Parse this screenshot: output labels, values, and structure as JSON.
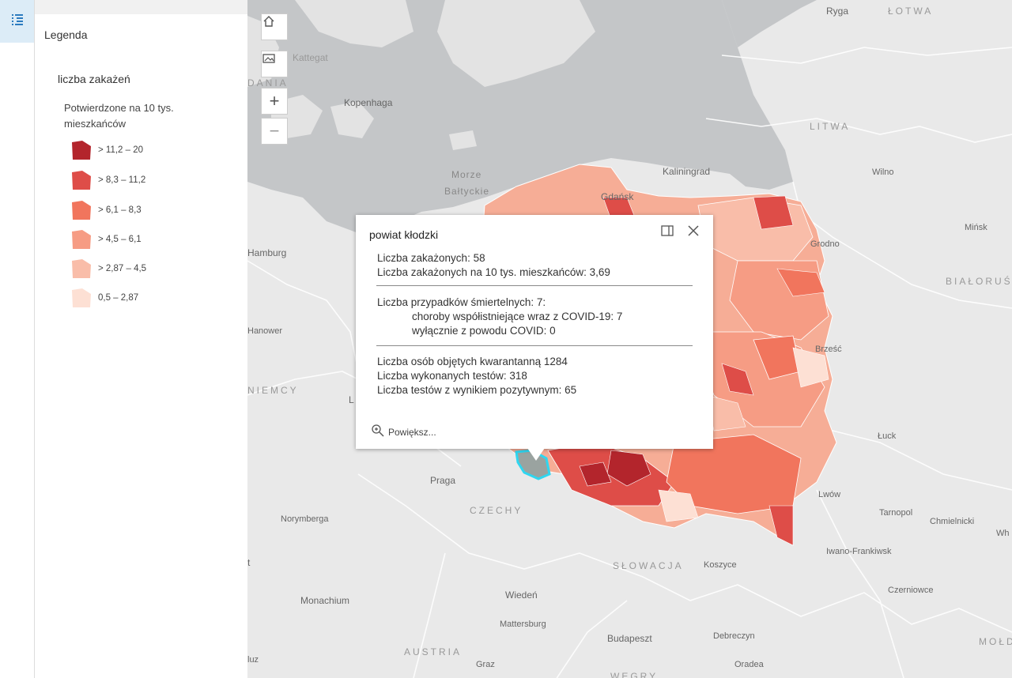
{
  "sidebar": {
    "legend_icon": "legend-list-icon"
  },
  "legend": {
    "title": "Legenda",
    "layer_title": "liczba zakażeń",
    "field_title": "Potwierdzone na 10 tys. mieszkańców",
    "items": [
      {
        "label": "> 11,2 – 20",
        "color": "#b3252c"
      },
      {
        "label": "> 8,3 – 11,2",
        "color": "#de4d48"
      },
      {
        "label": "> 6,1 – 8,3",
        "color": "#f1755d"
      },
      {
        "label": "> 4,5 – 6,1",
        "color": "#f69c84"
      },
      {
        "label": "> 2,87 – 4,5",
        "color": "#f9bda9"
      },
      {
        "label": "0,5 – 2,87",
        "color": "#fde0d4"
      }
    ]
  },
  "map_controls": {
    "home_icon": "home-icon",
    "basemap_icon": "basemap-gallery-icon",
    "zoom_in": "+",
    "zoom_out": "−"
  },
  "map_labels": {
    "ryga": "Ryga",
    "lotwa": "ŁOTWA",
    "kattegat": "Kattegat",
    "dania": "DANIA",
    "kopenhaga": "Kopenhaga",
    "litwa": "LITWA",
    "morze": "Morze",
    "baltyckie": "Bałtyckie",
    "kaliningrad": "Kaliningrad",
    "gdansk": "Gdańsk",
    "wilno": "Wilno",
    "minsk": "Mińsk",
    "grodno": "Grodno",
    "bialorus": "BIAŁORUŚ",
    "hamburg": "Hamburg",
    "hanower": "Hanower",
    "niemcy": "NIEMCY",
    "brzesc": "Brześć",
    "luck": "Łuck",
    "praga": "Praga",
    "czechy": "CZECHY",
    "lwow": "Lwów",
    "tarnopol": "Tarnopol",
    "chmielnicki": "Chmielnicki",
    "norymberga": "Norymberga",
    "iwano": "Iwano-Frankiwsk",
    "slowacja": "SŁOWACJA",
    "koszyce": "Koszyce",
    "monachium": "Monachium",
    "wieden": "Wiedeń",
    "czerniowce": "Czerniowce",
    "mattersburg": "Mattersburg",
    "budapeszt": "Budapeszt",
    "debreczyn": "Debreczyn",
    "austria": "AUSTRIA",
    "graz": "Graz",
    "oradea": "Oradea",
    "wegry": "WĘGRY",
    "moldawia": "MOŁD",
    "lodz": "Ł",
    "t": "t",
    "luz": "luz",
    "l": "L",
    "wh": "Wh"
  },
  "popup": {
    "title": "powiat kłodzki",
    "dock_icon": "dock-icon",
    "close_icon": "close-icon",
    "lines": {
      "cases": "Liczba zakażonych: 58",
      "cases_per_10k": "Liczba zakażonych na 10 tys. mieszkańców: 3,69",
      "deaths": "Liczba przypadków śmiertelnych: 7:",
      "comorbid": "choroby współistniejące wraz z COVID-19: 7",
      "covid_only": "wyłącznie z powodu COVID: 0",
      "quarantine": "Liczba osób objętych kwarantanną 1284",
      "tests": "Liczba wykonanych testów: 318",
      "positive": "Liczba testów z wynikiem pozytywnym: 65"
    },
    "zoom_label": "Powiększ..."
  },
  "colors": {
    "water": "#c4c6c8",
    "land": "#e9e9e9",
    "highlight": "#2fd6f0"
  }
}
